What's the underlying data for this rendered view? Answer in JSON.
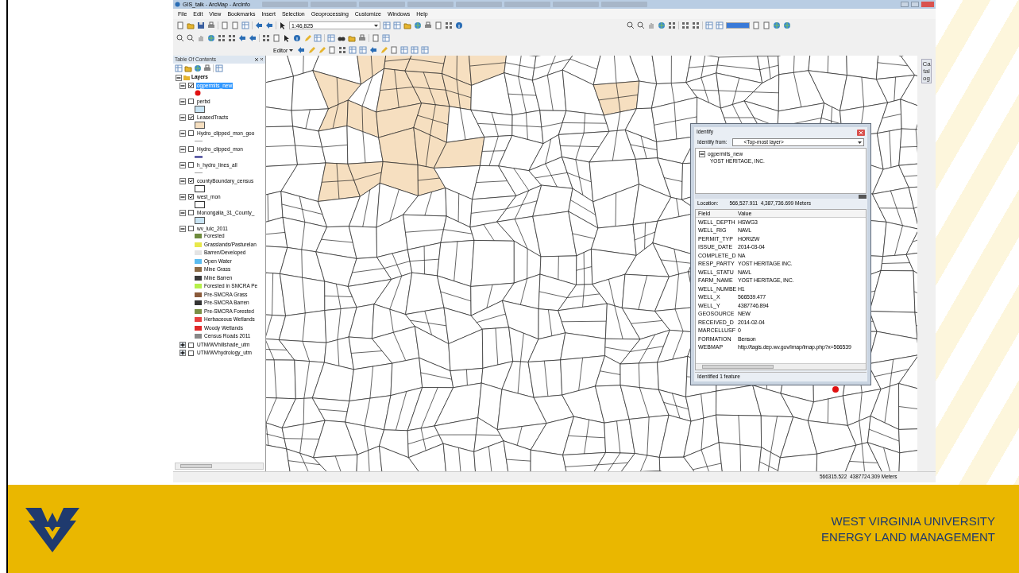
{
  "window": {
    "title": "GIS_talk - ArcMap - ArcInfo"
  },
  "menu": [
    "File",
    "Edit",
    "View",
    "Bookmarks",
    "Insert",
    "Selection",
    "Geoprocessing",
    "Customize",
    "Windows",
    "Help"
  ],
  "toolbar": {
    "scale": "1:46,825",
    "editor": "Editor"
  },
  "toc": {
    "title": "Table Of Contents",
    "root": {
      "label": "Layers",
      "expanded": true,
      "children": [
        {
          "label": "ogpermits_new",
          "checked": true,
          "selected": true,
          "expanded": true,
          "symbol": {
            "kind": "point",
            "color": "#e01010"
          }
        },
        {
          "label": "perbd",
          "checked": false,
          "selected": false,
          "expanded": true,
          "symbol": {
            "kind": "fill",
            "color": "#c8e4f4"
          }
        },
        {
          "label": "LeasedTracts",
          "checked": true,
          "selected": false,
          "expanded": true,
          "symbol": {
            "kind": "fill",
            "color": "#f6dfc0"
          }
        },
        {
          "label": "Hydro_clipped_mon_goo",
          "checked": false,
          "selected": false,
          "expanded": true,
          "symbol": {
            "kind": "line",
            "color": "#a0a0a0"
          }
        },
        {
          "label": "Hydro_clipped_mon",
          "checked": false,
          "selected": false,
          "expanded": true,
          "symbol": {
            "kind": "line",
            "color": "#1a1a80"
          }
        },
        {
          "label": "h_hydro_lines_all",
          "checked": false,
          "selected": false,
          "expanded": true,
          "symbol": {
            "kind": "line",
            "color": "#a0a0a0"
          }
        },
        {
          "label": "countyBoundary_census",
          "checked": true,
          "selected": false,
          "expanded": true,
          "symbol": {
            "kind": "outline"
          }
        },
        {
          "label": "west_mon",
          "checked": true,
          "selected": false,
          "expanded": true,
          "symbol": {
            "kind": "outline"
          }
        },
        {
          "label": "Monongalia_31_County_",
          "checked": false,
          "selected": false,
          "expanded": true,
          "symbol": {
            "kind": "fill",
            "color": "#c8e4f4"
          }
        },
        {
          "label": "wv_lulc_2011",
          "checked": false,
          "selected": false,
          "expanded": true,
          "classes": [
            {
              "label": "Forested",
              "color": "#6e8b3d"
            },
            {
              "label": "Grasslands/Pasturelan",
              "color": "#e8e84a"
            },
            {
              "label": "Barren/Developed",
              "color": "#e4e4e4"
            },
            {
              "label": "Open Water",
              "color": "#5bbcf0"
            },
            {
              "label": "Mine Grass",
              "color": "#8b6a45"
            },
            {
              "label": "Mine Barren",
              "color": "#3a3a3a"
            },
            {
              "label": "Forested in SMCRA Pe",
              "color": "#b5f04a"
            },
            {
              "label": "Pre-SMCRA Grass",
              "color": "#8a5a3a"
            },
            {
              "label": "Pre-SMCRA Barren",
              "color": "#333333"
            },
            {
              "label": "Pre-SMCRA Forested",
              "color": "#7a8f45"
            },
            {
              "label": "Herbaceous Wetlands",
              "color": "#e84040"
            },
            {
              "label": "Woody Wetlands",
              "color": "#e02828"
            },
            {
              "label": "Census Roads 2011",
              "color": "#888888"
            }
          ]
        },
        {
          "label": "UTM/WVhillshade_utm",
          "checked": false,
          "selected": false,
          "expanded": false
        },
        {
          "label": "UTM/WVhydrology_utm",
          "checked": false,
          "selected": false,
          "expanded": false
        }
      ]
    }
  },
  "identify": {
    "title": "Identify",
    "from_label": "Identify from:",
    "from_value": "<Top-most layer>",
    "tree": {
      "label": "ogpermits_new",
      "expanded": true,
      "children": [
        "YOST HERITAGE, INC."
      ]
    },
    "location_label": "Location:",
    "location": "566,527.911  4,387,736.699 Meters",
    "columns": [
      "Field",
      "Value"
    ],
    "rows": [
      [
        "WELL_DEPTH",
        "HSWG3"
      ],
      [
        "WELL_RIG",
        "NAVL"
      ],
      [
        "PERMIT_TYP",
        "HORIZW"
      ],
      [
        "ISSUE_DATE",
        "2014-03-04"
      ],
      [
        "COMPLETE_D",
        "NA"
      ],
      [
        "RESP_PARTY",
        "YOST HERITAGE INC."
      ],
      [
        "WELL_STATU",
        "NAVL"
      ],
      [
        "FARM_NAME",
        "YOST HERITAGE, INC."
      ],
      [
        "WELL_NUMBE",
        "H1"
      ],
      [
        "WELL_X",
        "566539.477"
      ],
      [
        "WELL_Y",
        "4387746.894"
      ],
      [
        "GEOSOURCE",
        "NEW"
      ],
      [
        "RECEIVED_D",
        "2014-02-04"
      ],
      [
        "MARCELLUSF",
        "0"
      ],
      [
        "FORMATION",
        "Benson"
      ],
      [
        "WEBMAP",
        "http://tagis.dep.wv.gov/imap/imap.php?x=566539"
      ]
    ],
    "status": "Identified 1 feature"
  },
  "side_tab": "Catalog",
  "status_bar": {
    "coordinates": "566315.522  4387724.309 Meters"
  },
  "slide": {
    "university": "WEST VIRGINIA UNIVERSITY",
    "program": "ENERGY LAND MANAGEMENT"
  }
}
